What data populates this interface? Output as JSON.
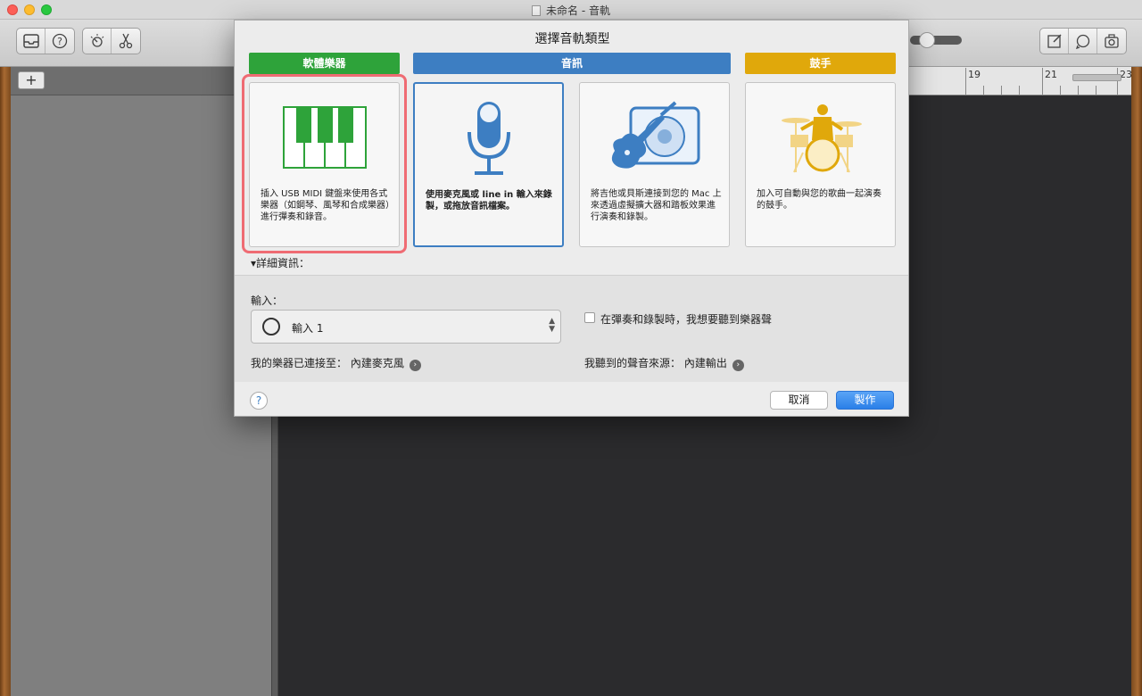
{
  "window": {
    "title": "未命名 - 音軌"
  },
  "toolbar": {
    "left_icons": [
      "library-icon",
      "help-icon"
    ],
    "mid_icons": [
      "smart-controls-icon",
      "scissors-icon"
    ],
    "right_icons": [
      "notepad-icon",
      "loops-icon",
      "media-browser-icon"
    ],
    "volume_level": 0.3
  },
  "track_header": {
    "add_label": "+"
  },
  "ruler": {
    "bars": [
      "19",
      "21",
      "23"
    ]
  },
  "dialog": {
    "title": "選擇音軌類型",
    "categories": {
      "software": "軟體樂器",
      "audio": "音訊",
      "drummer": "鼓手"
    },
    "cards": {
      "software": "插入 USB MIDI 鍵盤來使用各式樂器（如鋼琴、風琴和合成樂器）進行彈奏和錄音。",
      "mic": "使用麥克風或 line in 輸入來錄製，或拖放音訊檔案。",
      "guitar": "將吉他或貝斯連接到您的 Mac 上來透過虛擬擴大器和踏板效果進行演奏和錄製。",
      "drummer": "加入可自動與您的歌曲一起演奏的鼓手。"
    },
    "details_label": "▾詳細資訊：",
    "input_label": "輸入：",
    "input_value": "輸入 1",
    "monitor_label": "在彈奏和錄製時，我想要聽到樂器聲",
    "connected_to": "我的樂器已連接至：  內建麥克風",
    "output_to": "我聽到的聲音來源：  內建輸出",
    "help_label": "?",
    "cancel_label": "取消",
    "create_label": "製作"
  },
  "colors": {
    "software": "#2ea33a",
    "audio": "#3d7ec2",
    "drummer": "#e0a80b",
    "highlight": "#ef6b73"
  }
}
